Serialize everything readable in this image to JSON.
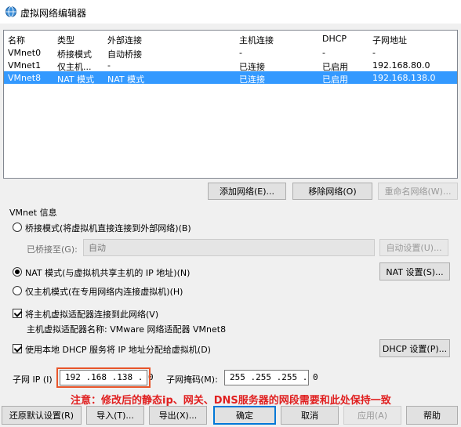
{
  "window": {
    "title": "虚拟网络编辑器"
  },
  "table": {
    "headers": [
      "名称",
      "类型",
      "外部连接",
      "主机连接",
      "DHCP",
      "子网地址"
    ],
    "rows": [
      [
        "VMnet0",
        "桥接模式",
        "自动桥接",
        "-",
        "-",
        "-"
      ],
      [
        "VMnet1",
        "仅主机...",
        "-",
        "已连接",
        "已启用",
        "192.168.80.0"
      ],
      [
        "VMnet8",
        "NAT 模式",
        "NAT 模式",
        "已连接",
        "已启用",
        "192.168.138.0"
      ]
    ],
    "selected_row": 2
  },
  "network_buttons": {
    "add": "添加网络(E)...",
    "remove": "移除网络(O)",
    "rename": "重命名网络(W)..."
  },
  "vmnet_info": {
    "section_title": "VMnet 信息",
    "bridge_radio": "桥接模式(将虚拟机直接连接到外部网络)(B)",
    "bridged_to_label": "已桥接至(G):",
    "bridged_to_value": "自动",
    "auto_settings": "自动设置(U)...",
    "nat_radio": "NAT 模式(与虚拟机共享主机的 IP 地址)(N)",
    "nat_settings": "NAT 设置(S)...",
    "hostonly_radio": "仅主机模式(在专用网络内连接虚拟机)(H)",
    "connect_adapter_check": "将主机虚拟适配器连接到此网络(V)",
    "adapter_name": "主机虚拟适配器名称: VMware 网络适配器 VMnet8",
    "dhcp_check": "使用本地 DHCP 服务将 IP 地址分配给虚拟机(D)",
    "dhcp_settings": "DHCP 设置(P)...",
    "subnet_ip_label": "子网 IP (I)",
    "subnet_ip_value": "192 .168 .138 . 0",
    "subnet_mask_label": "子网掩码(M):",
    "subnet_mask_value": "255 .255 .255 . 0"
  },
  "annotation": {
    "note": "注意：修改后的静态ip、网关、DNS服务器的网段需要和此处保持一致",
    "color": "#e02020"
  },
  "footer_buttons": {
    "restore": "还原默认设置(R)",
    "import": "导入(T)...",
    "export": "导出(X)...",
    "ok": "确定",
    "cancel": "取消",
    "apply": "应用(A)",
    "help": "帮助"
  },
  "colors": {
    "selection": "#3399ff",
    "highlight_box": "#e8552a"
  }
}
